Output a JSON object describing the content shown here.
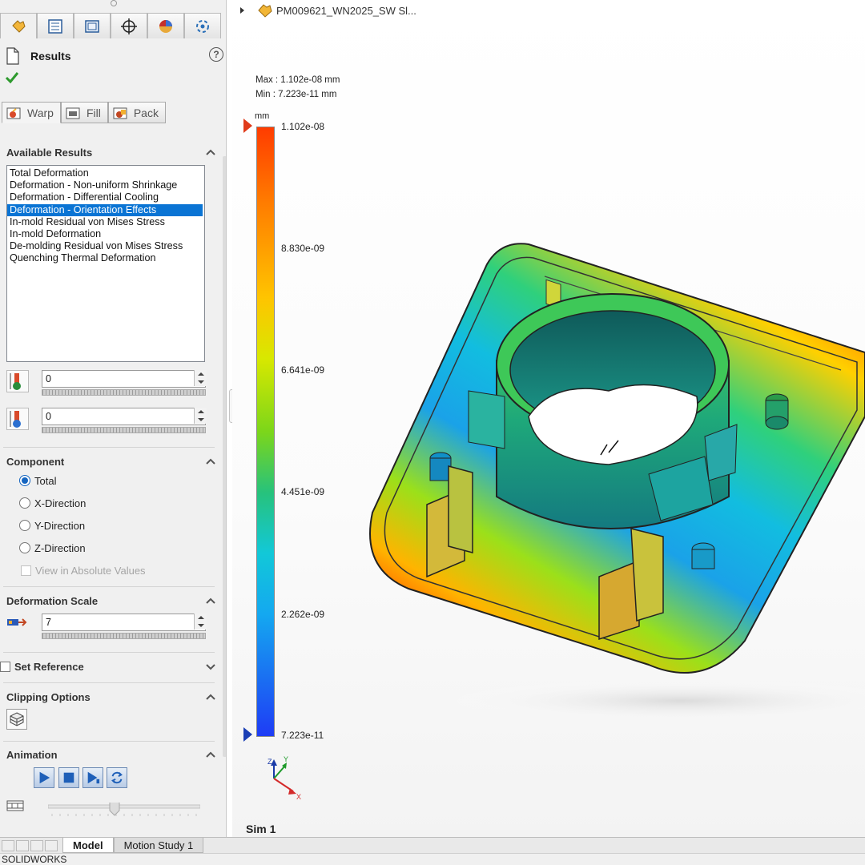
{
  "panel": {
    "title": "Results",
    "help_glyph": "?",
    "top_tabs": [
      {
        "icon": "simulation-icon",
        "active": true
      },
      {
        "icon": "feature-tree-icon",
        "active": false
      },
      {
        "icon": "property-manager-icon",
        "active": false
      },
      {
        "icon": "target-icon",
        "active": false
      },
      {
        "icon": "appearance-icon",
        "active": false
      },
      {
        "icon": "display-manager-icon",
        "active": false
      }
    ],
    "sub_tabs": [
      {
        "label": "Warp",
        "active": true
      },
      {
        "label": "Fill",
        "active": false
      },
      {
        "label": "Pack",
        "active": false
      }
    ],
    "available_results": {
      "header": "Available Results",
      "items": [
        "Total Deformation",
        "Deformation - Non-uniform Shrinkage",
        "Deformation - Differential Cooling",
        "Deformation - Orientation Effects",
        "In-mold Residual von Mises Stress",
        "In-mold Deformation",
        "De-molding Residual von Mises Stress",
        "Quenching Thermal Deformation"
      ],
      "selected_index": 3
    },
    "value_fields": [
      "0",
      "0"
    ],
    "component": {
      "header": "Component",
      "options": [
        "Total",
        "X-Direction",
        "Y-Direction",
        "Z-Direction"
      ],
      "selected": "Total",
      "absolute_label": "View in Absolute Values"
    },
    "deformation_scale": {
      "header": "Deformation Scale",
      "value": "7"
    },
    "set_reference": {
      "label": "Set Reference"
    },
    "clipping": {
      "header": "Clipping Options"
    },
    "animation": {
      "header": "Animation"
    }
  },
  "viewport": {
    "document_name": "PM009621_WN2025_SW Sl...",
    "max_label": "Max : 1.102e-08 mm",
    "min_label": "Min : 7.223e-11 mm",
    "unit": "mm",
    "legend_ticks": [
      "1.102e-08",
      "8.830e-09",
      "6.641e-09",
      "4.451e-09",
      "2.262e-09",
      "7.223e-11"
    ],
    "study_label": "Sim 1",
    "colors": {
      "max": "#ff3c00",
      "min": "#1e3cf5"
    }
  },
  "bottom_tabs": [
    "Model",
    "Motion Study 1"
  ],
  "status": "SOLIDWORKS"
}
